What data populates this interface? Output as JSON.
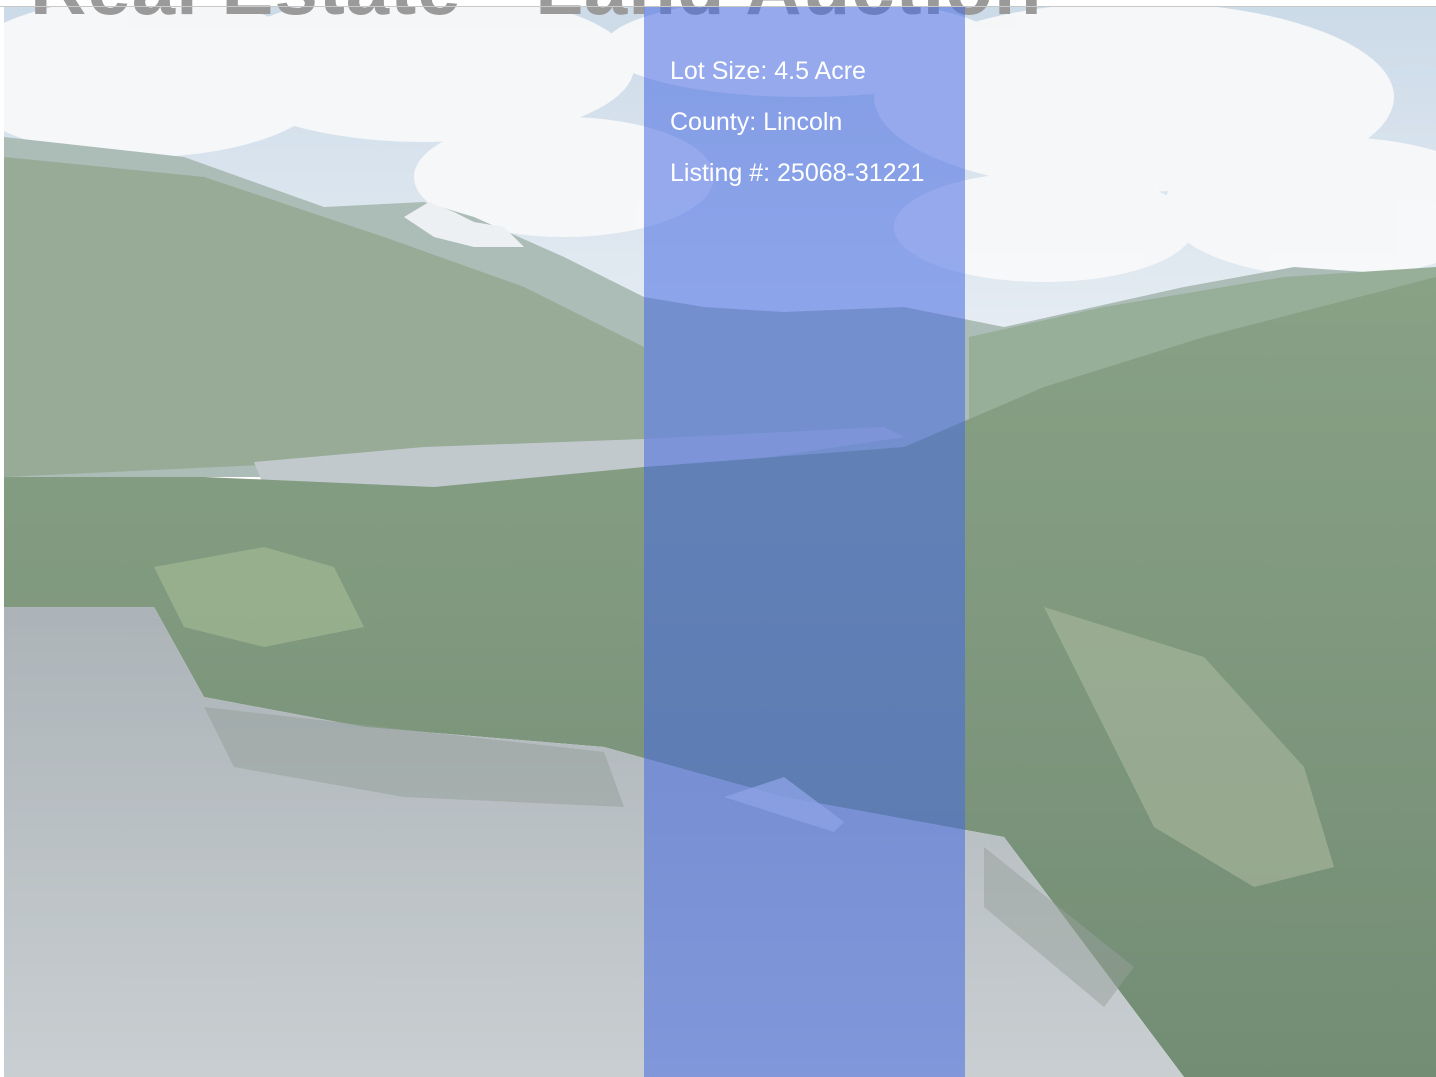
{
  "header": {
    "title": "Real Estate • Land Auction"
  },
  "listing": {
    "lot_size": "Lot Size: 4.5 Acre",
    "county": "County: Lincoln",
    "listing_number": "Listing #: 25068-31221"
  },
  "colors": {
    "panel_blue": "#4669e1",
    "sky": "#d8e2ec",
    "forest": "#3f6b3f",
    "lake": "#9aa6ad"
  }
}
